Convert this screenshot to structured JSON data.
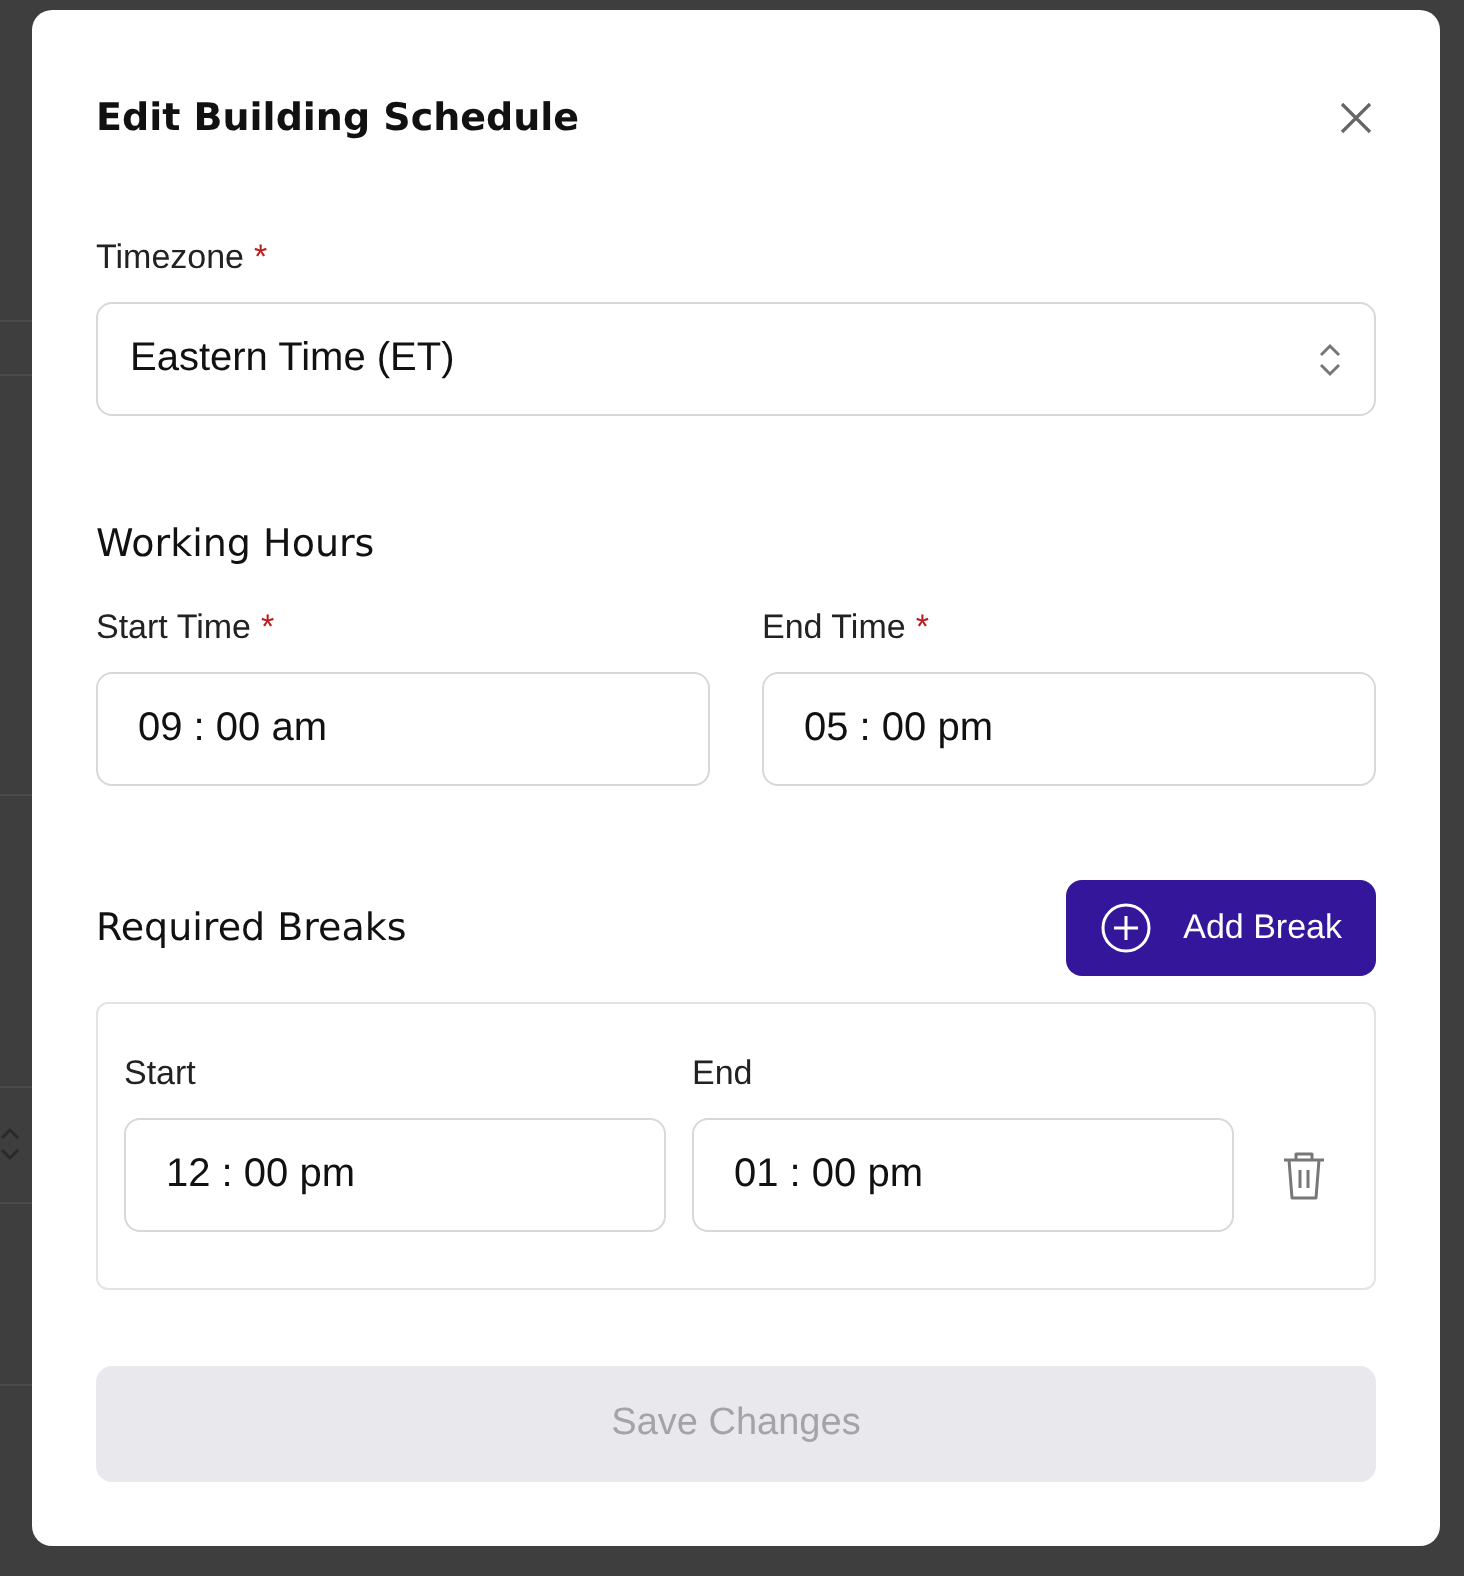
{
  "dialog": {
    "title": "Edit Building Schedule"
  },
  "timezone": {
    "label": "Timezone",
    "required_mark": "*",
    "value": "Eastern Time (ET)"
  },
  "working_hours": {
    "heading": "Working Hours",
    "fields": [
      {
        "label": "Start Time",
        "required_mark": "*",
        "value": "09 : 00 am"
      },
      {
        "label": "End Time",
        "required_mark": "*",
        "value": "05 : 00 pm"
      }
    ]
  },
  "required_breaks": {
    "heading": "Required Breaks",
    "add_button": "Add Break",
    "breaks": [
      {
        "start_label": "Start",
        "start_value": "12 : 00 pm",
        "end_label": "End",
        "end_value": "01 : 00 pm"
      }
    ]
  },
  "save_button": {
    "label": "Save Changes",
    "disabled": true
  }
}
